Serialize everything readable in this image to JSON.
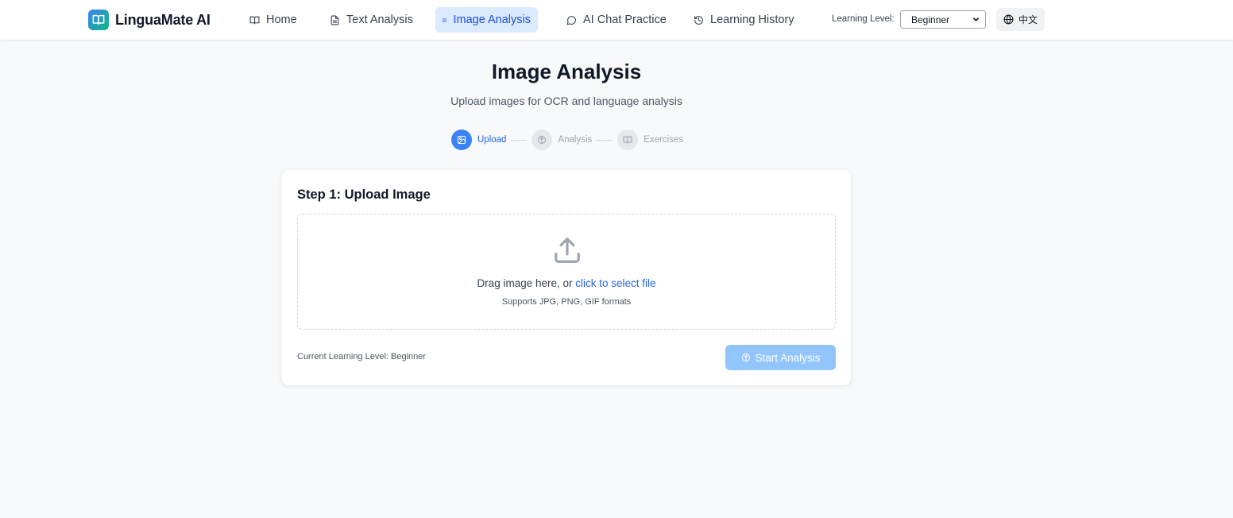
{
  "app": {
    "name": "LinguaMate AI",
    "logo_icon": "book-open-icon"
  },
  "nav": {
    "items": [
      {
        "label": "Home",
        "icon": "book-icon"
      },
      {
        "label": "Text Analysis",
        "icon": "document-icon"
      },
      {
        "label": "Image Analysis",
        "icon": "image-icon",
        "active": true
      },
      {
        "label": "AI Chat Practice",
        "icon": "chat-bubble-icon"
      },
      {
        "label": "Learning History",
        "icon": "history-icon"
      }
    ],
    "level_label": "Learning Level:",
    "level_value": "Beginner",
    "language_button": "中文"
  },
  "page": {
    "title": "Image Analysis",
    "subtitle": "Upload images for OCR and language analysis"
  },
  "stepper": [
    {
      "label": "Upload",
      "icon": "image-icon",
      "active": true
    },
    {
      "label": "Analysis",
      "icon": "brain-icon",
      "active": false
    },
    {
      "label": "Exercises",
      "icon": "book-icon",
      "active": false
    }
  ],
  "card": {
    "title": "Step 1: Upload Image",
    "drop_text": "Drag image here, or ",
    "drop_link": "click to select file",
    "drop_hint": "Supports JPG, PNG, GIF formats",
    "current_level": "Current Learning Level: Beginner",
    "start_button": "Start Analysis"
  },
  "colors": {
    "accent": "#3b82f6",
    "active_nav_bg": "#dbeafe",
    "disabled_button": "#93c5fd",
    "background": "#f8f9fb"
  }
}
